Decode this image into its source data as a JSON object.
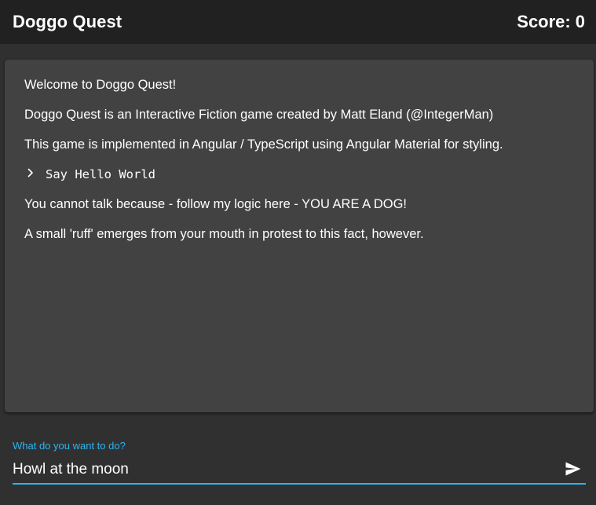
{
  "header": {
    "title": "Doggo Quest",
    "score_label": "Score:",
    "score_value": "0"
  },
  "story": {
    "lines": [
      "Welcome to Doggo Quest!",
      "Doggo Quest is an Interactive Fiction game created by Matt Eland (@IntegerMan)",
      "This game is implemented in Angular / TypeScript using Angular Material for styling."
    ],
    "command": {
      "icon": "chevron-right-icon",
      "text": "Say Hello World"
    },
    "responses": [
      "You cannot talk because - follow my logic here - YOU ARE A DOG!",
      "A small 'ruff' emerges from your mouth in protest to this fact, however."
    ]
  },
  "input": {
    "label": "What do you want to do?",
    "value": "Howl at the moon",
    "send_icon": "send-icon"
  },
  "colors": {
    "background": "#303030",
    "toolbar": "#212121",
    "card": "#424242",
    "accent": "#29b6f6",
    "text": "#ffffff"
  }
}
